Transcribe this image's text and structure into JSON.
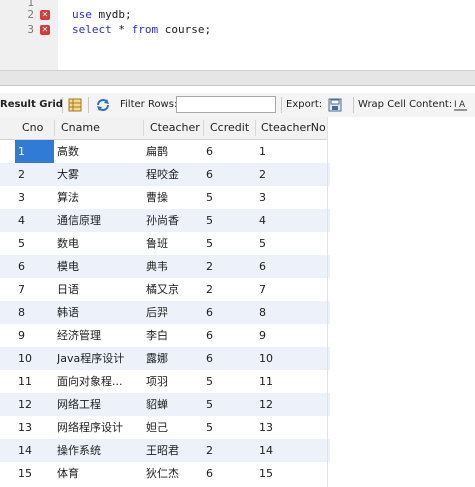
{
  "editor": {
    "lines": [
      {
        "num": "1",
        "error": false,
        "keyword": "",
        "rest": ""
      },
      {
        "num": "2",
        "error": true,
        "keyword": "use",
        "rest": " mydb;"
      },
      {
        "num": "3",
        "error": true,
        "keyword": "select",
        "rest": " * from course;"
      }
    ],
    "error_icon": "error-x-icon"
  },
  "toolbar": {
    "result_grid_label": "Result Grid",
    "filter_rows_label": "Filter Rows:",
    "filter_value": "",
    "export_label": "Export:",
    "wrap_label": "Wrap Cell Content:",
    "icons": [
      "grid-icon",
      "refresh-icon",
      "export-icon",
      "wrap-icon"
    ]
  },
  "grid": {
    "columns": [
      "Cno",
      "Cname",
      "Cteacher",
      "Ccredit",
      "CteacherNo"
    ],
    "selected_row": 0,
    "rows": [
      [
        "1",
        "高数",
        "扁鹊",
        "6",
        "1"
      ],
      [
        "2",
        "大雾",
        "程咬金",
        "6",
        "2"
      ],
      [
        "3",
        "算法",
        "曹操",
        "5",
        "3"
      ],
      [
        "4",
        "通信原理",
        "孙尚香",
        "5",
        "4"
      ],
      [
        "5",
        "数电",
        "鲁班",
        "5",
        "5"
      ],
      [
        "6",
        "模电",
        "典韦",
        "2",
        "6"
      ],
      [
        "7",
        "日语",
        "橘又京",
        "2",
        "7"
      ],
      [
        "8",
        "韩语",
        "后羿",
        "6",
        "8"
      ],
      [
        "9",
        "经济管理",
        "李白",
        "6",
        "9"
      ],
      [
        "10",
        "Java程序设计",
        "露娜",
        "6",
        "10"
      ],
      [
        "11",
        "面向对象程...",
        "项羽",
        "5",
        "11"
      ],
      [
        "12",
        "网络工程",
        "貂蝉",
        "5",
        "12"
      ],
      [
        "13",
        "网络程序设计",
        "妲己",
        "5",
        "13"
      ],
      [
        "14",
        "操作系统",
        "王昭君",
        "2",
        "14"
      ],
      [
        "15",
        "体育",
        "狄仁杰",
        "6",
        "15"
      ]
    ]
  }
}
